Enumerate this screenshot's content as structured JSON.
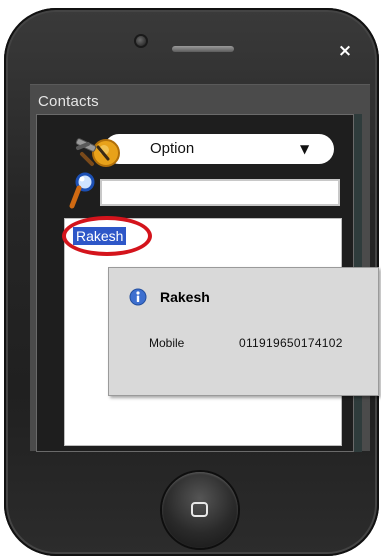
{
  "window": {
    "close_glyph": "×",
    "title": "Contacts"
  },
  "toolbar": {
    "option_label": "Option",
    "option_arrow": "▼",
    "tools_icon": "tools-icon",
    "search_icon": "magnifier-icon",
    "search_value": ""
  },
  "contacts": {
    "selected": "Rakesh"
  },
  "popup": {
    "icon": "info-icon",
    "name": "Rakesh",
    "mobile_label": "Mobile",
    "mobile_value": "011919650174102"
  },
  "colors": {
    "selection": "#2e57c8",
    "highlight_ring": "#d4141c",
    "info_icon": "#3d6fcf"
  },
  "home_button": {
    "icon": "home-square-icon"
  }
}
